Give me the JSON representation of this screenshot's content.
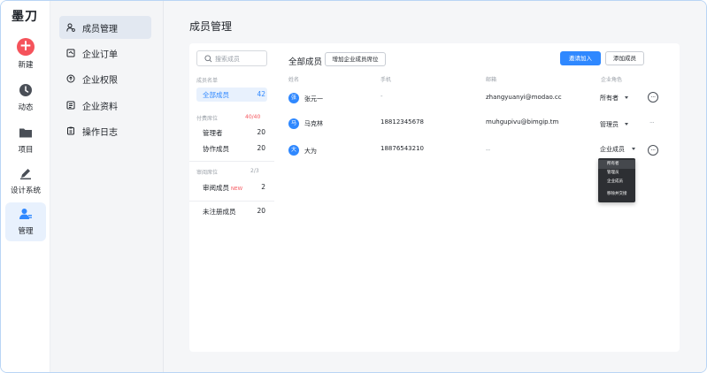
{
  "app": {
    "logo_text": "墨刀"
  },
  "rail": {
    "items": [
      {
        "label": "新建",
        "icon": "plus-icon"
      },
      {
        "label": "动态",
        "icon": "clock-icon"
      },
      {
        "label": "项目",
        "icon": "folder-icon"
      },
      {
        "label": "设计系统",
        "icon": "pen-icon"
      },
      {
        "label": "管理",
        "icon": "user-manage-icon",
        "active": true
      }
    ]
  },
  "submenu": {
    "items": [
      {
        "label": "成员管理",
        "icon": "members-icon",
        "active": true
      },
      {
        "label": "企业订单",
        "icon": "order-icon"
      },
      {
        "label": "企业权限",
        "icon": "permission-icon"
      },
      {
        "label": "企业资料",
        "icon": "profile-icon"
      },
      {
        "label": "操作日志",
        "icon": "log-icon"
      }
    ]
  },
  "page": {
    "title": "成员管理"
  },
  "groups": {
    "search_placeholder": "搜索成员",
    "member_list_title": "成员名单",
    "all_members": {
      "label": "全部成员",
      "count": "42"
    },
    "paid_title": "付费席位",
    "paid_meta": "40/40",
    "admin": {
      "label": "管理者",
      "count": "20"
    },
    "collaborator": {
      "label": "协作成员",
      "count": "20"
    },
    "review_title": "审阅席位",
    "review_meta": "2/3",
    "reviewer": {
      "label": "审阅成员",
      "badge": "NEW",
      "count": "2"
    },
    "unregistered": {
      "label": "未注册成员",
      "count": "20"
    }
  },
  "list": {
    "title": "全部成员",
    "add_seat_button": "增加企业成员席位",
    "invite_button": "邀请加入",
    "add_member_button": "添加成员",
    "columns": {
      "name": "姓名",
      "phone": "手机",
      "email": "邮箱",
      "role": "企业角色"
    },
    "rows": [
      {
        "avatar": "张",
        "name": "张元一",
        "phone": "-",
        "email": "zhangyuanyi@modao.cc",
        "role": "所有者"
      },
      {
        "avatar": "马",
        "name": "马克林",
        "phone": "18812345678",
        "email": "muhgupivu@bimgip.tm",
        "role": "管理员"
      },
      {
        "avatar": "大",
        "name": "大为",
        "phone": "18876543210",
        "email": "--",
        "role": "企业成员"
      }
    ]
  },
  "role_dropdown": {
    "options": [
      "所有者",
      "管理员",
      "企业成员",
      "移除并交接"
    ],
    "selected": "所有者"
  },
  "colors": {
    "primary": "#2f88ff",
    "danger": "#f5535b",
    "new_badge": "#f5535b"
  }
}
